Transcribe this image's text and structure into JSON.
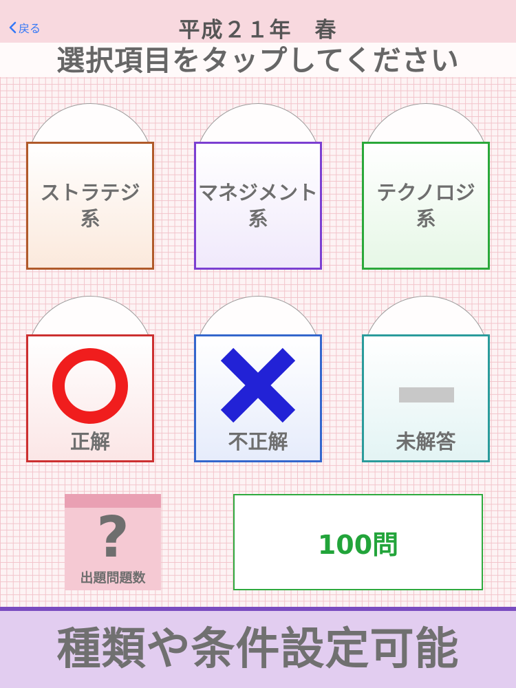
{
  "navbar": {
    "back_label": "戻る",
    "title": "平成２１年　春"
  },
  "instruction": "選択項目をタップしてください",
  "categories": [
    {
      "label": "ストラテジ\n系",
      "color": "#b05a2a"
    },
    {
      "label": "マネジメント\n系",
      "color": "#7b3fd1"
    },
    {
      "label": "テクノロジ\n系",
      "color": "#2aa83a"
    }
  ],
  "answer_filters": [
    {
      "label": "正解",
      "icon": "circle-icon",
      "color": "#f01d1d"
    },
    {
      "label": "不正解",
      "icon": "cross-icon",
      "color": "#2222d6"
    },
    {
      "label": "未解答",
      "icon": "dash-icon",
      "color": "#2a9b9b"
    }
  ],
  "question_count": {
    "icon": "question-mark-icon",
    "icon_text": "?",
    "label": "出題問題数",
    "value": "100問",
    "value_color": "#22a43a"
  },
  "banner": "種類や条件設定可能"
}
